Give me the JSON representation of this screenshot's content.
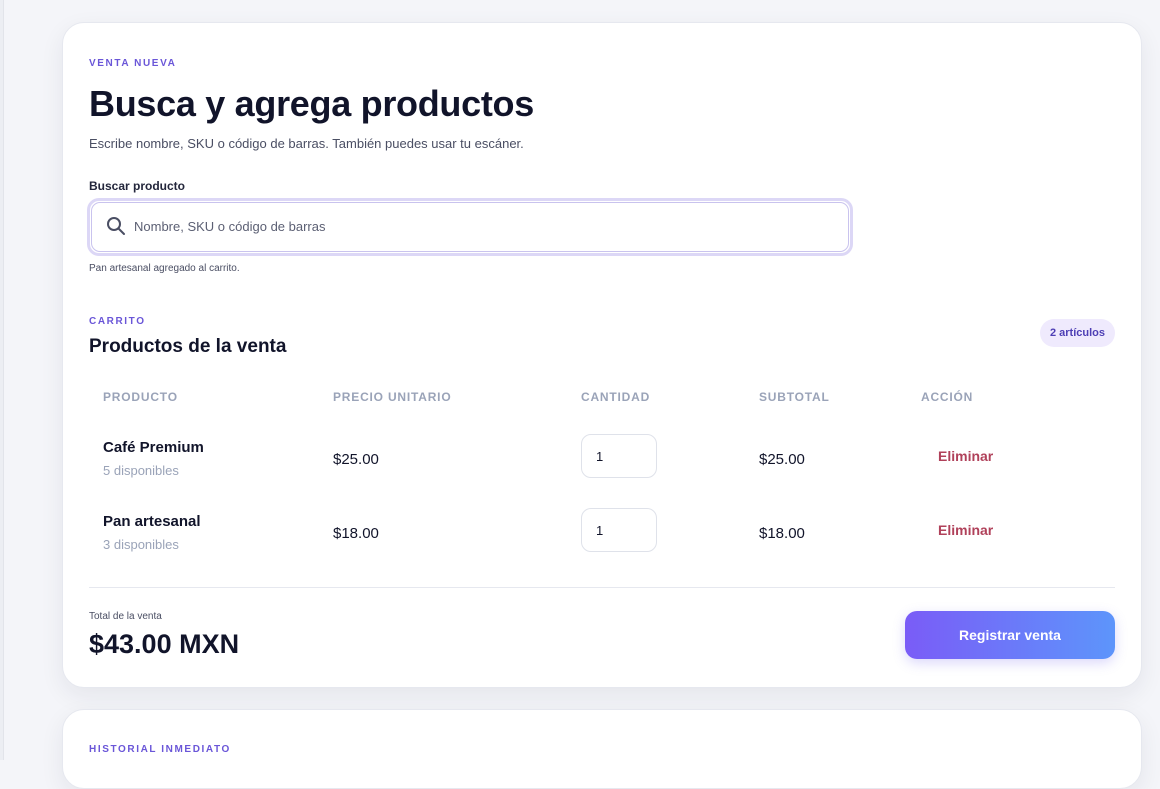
{
  "sale": {
    "eyebrow": "VENTA NUEVA",
    "title": "Busca y agrega productos",
    "subtitle": "Escribe nombre, SKU o código de barras. También puedes usar tu escáner.",
    "search": {
      "label": "Buscar producto",
      "placeholder": "Nombre, SKU o código de barras",
      "value": "",
      "status": "Pan artesanal agregado al carrito."
    }
  },
  "cart": {
    "eyebrow": "CARRITO",
    "title": "Productos de la venta",
    "count_badge": "2 artículos",
    "columns": [
      "PRODUCTO",
      "PRECIO UNITARIO",
      "CANTIDAD",
      "SUBTOTAL",
      "ACCIÓN"
    ],
    "items": [
      {
        "name": "Café Premium",
        "stock": "5 disponibles",
        "price": "$25.00",
        "quantity": "1",
        "subtotal": "$25.00",
        "action": "Eliminar"
      },
      {
        "name": "Pan artesanal",
        "stock": "3 disponibles",
        "price": "$18.00",
        "quantity": "1",
        "subtotal": "$18.00",
        "action": "Eliminar"
      }
    ],
    "total_label": "Total de la venta",
    "total_value": "$43.00 MXN",
    "register_label": "Registrar venta"
  },
  "history": {
    "eyebrow": "HISTORIAL INMEDIATO"
  },
  "colors": {
    "accent": "#6a56d8",
    "danger": "#b0415a",
    "gradient_start": "#7a5cf7",
    "gradient_end": "#5d95fb"
  },
  "icons": {
    "search": "search-icon"
  }
}
